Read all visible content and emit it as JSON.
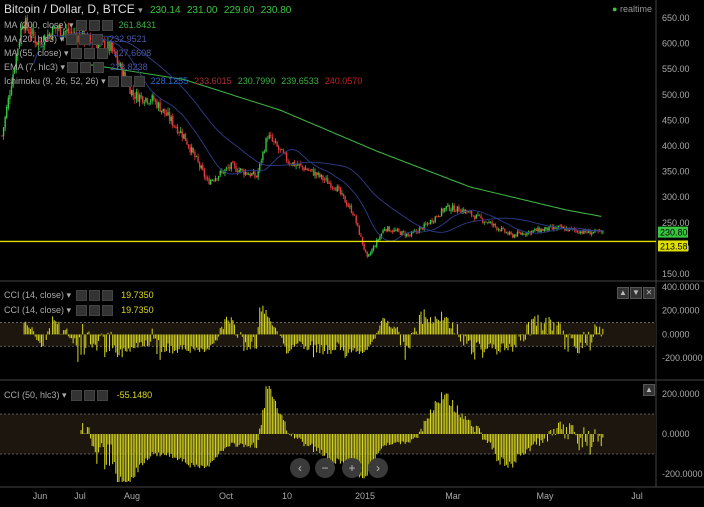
{
  "header": {
    "symbol_title": "Bitcoin / Dollar, D, BTCE",
    "ohlc": [
      "230.14",
      "231.00",
      "229.60",
      "230.80"
    ],
    "realtime_label": "realtime"
  },
  "indicators": [
    {
      "label": "MA (200, close)",
      "values": [
        "261.8431"
      ],
      "colors": [
        "#3cb043"
      ]
    },
    {
      "label": "MA (20, hlc3)",
      "values": [
        "232.9521"
      ],
      "colors": [
        "#4a5aa8"
      ]
    },
    {
      "label": "MA (55, close)",
      "values": [
        "227.6608"
      ],
      "colors": [
        "#4a5aa8"
      ]
    },
    {
      "label": "EMA (7, hlc3)",
      "values": [
        "228.8238"
      ],
      "colors": [
        "#4a5aa8"
      ]
    },
    {
      "label": "Ichimoku (9, 26, 52, 26)",
      "values": [
        "228.1255",
        "233.6015",
        "230.7990",
        "239.6533",
        "240.0570"
      ],
      "colors": [
        "#2a6ad0",
        "#b03030",
        "#3cb043",
        "#3cb043",
        "#c02020"
      ]
    }
  ],
  "cci_panel_1": {
    "rows": [
      {
        "label": "CCI (14, close)",
        "value": "19.7350"
      },
      {
        "label": "CCI (14, close)",
        "value": "19.7350"
      }
    ]
  },
  "cci_panel_2": {
    "rows": [
      {
        "label": "CCI (50, hlc3)",
        "value": "-55.1480"
      }
    ]
  },
  "x_axis_labels": [
    "Jun",
    "Jul",
    "Aug",
    "Oct",
    "10",
    "2015",
    "Mar",
    "May",
    "Jul"
  ],
  "price_axis_labels": [
    "650.00",
    "600.00",
    "550.00",
    "500.00",
    "450.00",
    "400.00",
    "350.00",
    "300.00",
    "250.00",
    "200.00",
    "150.00"
  ],
  "price_badges": {
    "last": "230.80",
    "line": "213.58"
  },
  "cci1_axis_labels": [
    "400.0000",
    "200.0000",
    "0.0000",
    "-200.0000"
  ],
  "cci2_axis_labels": [
    "200.0000",
    "0.0000",
    "-200.0000"
  ],
  "colors": {
    "up": "#39c53f",
    "down": "#e23a3a",
    "ma200": "#3cb043",
    "ma_blue": "#2c3d8a",
    "cci_fill": "#d8d820",
    "hline": "#e0e000",
    "badge_last": "#39c53f",
    "badge_line": "#e0e000"
  },
  "chart_data": [
    {
      "type": "candlestick",
      "title": "Bitcoin / Dollar, D, BTCE",
      "ylim": [
        140,
        660
      ],
      "y_ticks": [
        150,
        200,
        250,
        300,
        350,
        400,
        450,
        500,
        550,
        600,
        650
      ],
      "x_ticks": [
        "Jun",
        "Jul",
        "Aug",
        "Oct",
        "10",
        "2015",
        "Mar",
        "May",
        "Jul"
      ],
      "horizontal_line": 213.58,
      "last_price": 230.8,
      "close_path_approx": [
        {
          "x": "May 28",
          "y": 420
        },
        {
          "x": "Jun 05",
          "y": 560
        },
        {
          "x": "Jun 10",
          "y": 645
        },
        {
          "x": "Jun 20",
          "y": 600
        },
        {
          "x": "Jul 01",
          "y": 630
        },
        {
          "x": "Jul 20",
          "y": 610
        },
        {
          "x": "Aug 05",
          "y": 590
        },
        {
          "x": "Aug 19",
          "y": 500
        },
        {
          "x": "Sep 01",
          "y": 490
        },
        {
          "x": "Sep 20",
          "y": 420
        },
        {
          "x": "Oct 05",
          "y": 330
        },
        {
          "x": "Oct 20",
          "y": 360
        },
        {
          "x": "Nov 05",
          "y": 340
        },
        {
          "x": "Nov 12",
          "y": 420
        },
        {
          "x": "Nov 25",
          "y": 370
        },
        {
          "x": "Dec 10",
          "y": 350
        },
        {
          "x": "Dec 25",
          "y": 320
        },
        {
          "x": "Jan 05",
          "y": 270
        },
        {
          "x": "Jan 14",
          "y": 180
        },
        {
          "x": "Jan 25",
          "y": 240
        },
        {
          "x": "Feb 10",
          "y": 225
        },
        {
          "x": "Feb 20",
          "y": 245
        },
        {
          "x": "Mar 05",
          "y": 280
        },
        {
          "x": "Mar 15",
          "y": 275
        },
        {
          "x": "Apr 01",
          "y": 250
        },
        {
          "x": "Apr 15",
          "y": 225
        },
        {
          "x": "May 01",
          "y": 235
        },
        {
          "x": "May 15",
          "y": 240
        },
        {
          "x": "Jun 01",
          "y": 232
        },
        {
          "x": "Jun 12",
          "y": 230.8
        }
      ],
      "ma200_path_approx": [
        {
          "x": "Jul 20",
          "y": 560
        },
        {
          "x": "Sep 20",
          "y": 530
        },
        {
          "x": "Nov 20",
          "y": 470
        },
        {
          "x": "Jan 20",
          "y": 390
        },
        {
          "x": "Mar 20",
          "y": 320
        },
        {
          "x": "May 20",
          "y": 275
        },
        {
          "x": "Jun 12",
          "y": 262
        }
      ]
    },
    {
      "type": "histogram",
      "title": "CCI (14, close)",
      "ylim": [
        -300,
        400
      ],
      "reference_lines": [
        100,
        -100
      ],
      "last_value": 19.735
    },
    {
      "type": "histogram",
      "title": "CCI (50, hlc3)",
      "ylim": [
        -250,
        250
      ],
      "reference_lines": [
        100,
        -100
      ],
      "last_value": -55.148
    }
  ]
}
